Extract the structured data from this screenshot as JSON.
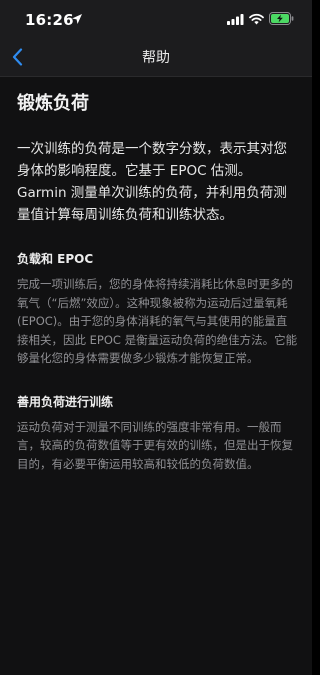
{
  "status_bar": {
    "time": "16:26"
  },
  "nav": {
    "title": "帮助"
  },
  "article": {
    "title": "锻炼负荷",
    "intro": "一次训练的负荷是一个数字分数，表示其对您身体的影响程度。它基于 EPOC 估测。Garmin 测量单次训练的负荷，并利用负荷测量值计算每周训练负荷和训练状态。",
    "sections": [
      {
        "heading": "负载和 EPOC",
        "body": "完成一项训练后，您的身体将持续消耗比休息时更多的氧气（“后燃”效应）。这种现象被称为运动后过量氧耗 (EPOC)。由于您的身体消耗的氧气与其使用的能量直接相关，因此 EPOC 是衡量运动负荷的绝佳方法。它能够量化您的身体需要做多少锻炼才能恢复正常。"
      },
      {
        "heading": "善用负荷进行训练",
        "body": "运动负荷对于测量不同训练的强度非常有用。一般而言，较高的负荷数值等于更有效的训练，但是出于恢复目的，有必要平衡运用较高和较低的负荷数值。"
      }
    ]
  },
  "colors": {
    "background": "#111112",
    "bar": "#1c1c1e",
    "accent": "#2f8cf0",
    "battery": "#4cd964",
    "muted_text": "#8f8f93"
  }
}
